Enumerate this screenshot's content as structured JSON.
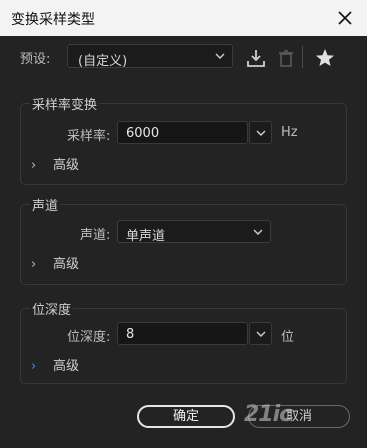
{
  "window": {
    "title": "变换采样类型"
  },
  "preset": {
    "label": "预设:",
    "value": "(自定义)"
  },
  "samplerate_group": {
    "title": "采样率变换",
    "field_label": "采样率:",
    "value": "6000",
    "unit": "Hz",
    "advanced": "高级"
  },
  "channel_group": {
    "title": "声道",
    "field_label": "声道:",
    "value": "单声道",
    "advanced": "高级"
  },
  "bitdepth_group": {
    "title": "位深度",
    "field_label": "位深度:",
    "value": "8",
    "unit": "位",
    "advanced": "高级"
  },
  "buttons": {
    "ok": "确定",
    "cancel": "取消"
  },
  "watermark": "21ic",
  "colors": {
    "accent_blue": "#4a8fe0",
    "background": "#232323"
  }
}
